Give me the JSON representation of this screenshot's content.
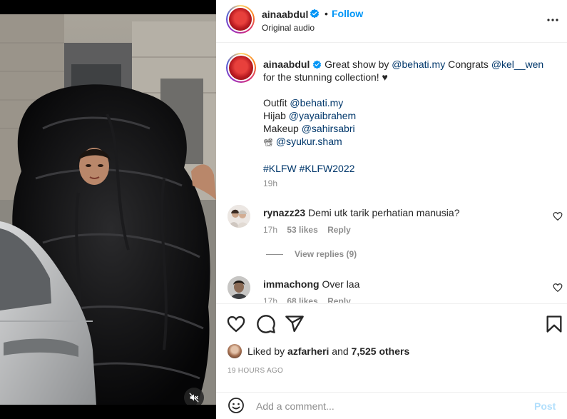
{
  "header": {
    "username": "ainaabdul",
    "separator": "•",
    "follow_label": "Follow",
    "audio": "Original audio",
    "more_icon": "more-horizontal-icon"
  },
  "caption": {
    "username": "ainaabdul",
    "text1": "Great show by",
    "mention1": "@behati.my",
    "text2": "Congrats",
    "mention2": "@kel__wen",
    "text3": "for the stunning collection! ♥",
    "outfit_label": "Outfit",
    "outfit_mention": "@behati.my",
    "hijab_label": "Hijab",
    "hijab_mention": "@yayaibrahem",
    "makeup_label": "Makeup",
    "makeup_mention": "@sahirsabri",
    "camera_emoji": "📽",
    "camera_mention": "@syukur.sham",
    "hashtag1": "#KLFW",
    "hashtag2": "#KLFW2022",
    "time": "19h"
  },
  "comments": [
    {
      "username": "rynazz23",
      "text": "Demi utk tarik perhatian manusia?",
      "time": "17h",
      "likes": "53 likes",
      "reply": "Reply",
      "view_replies": "View replies (9)"
    },
    {
      "username": "immachong",
      "text": "Over laa",
      "time": "17h",
      "likes": "68 likes",
      "reply": "Reply"
    }
  ],
  "actions": {
    "icons": [
      "heart-icon",
      "comment-icon",
      "share-icon",
      "bookmark-icon"
    ],
    "liked_by_prefix": "Liked by",
    "liked_by_user": "azfarheri",
    "liked_by_and": "and",
    "liked_by_others": "7,525 others",
    "date": "19 HOURS AGO"
  },
  "add_comment": {
    "placeholder": "Add a comment...",
    "post_label": "Post",
    "emoji_icon": "smiley-icon"
  },
  "media": {
    "mute_icon": "speaker-muted-icon"
  },
  "colors": {
    "accent": "#0095f6",
    "mention": "#00376b",
    "muted": "#8e8e8e",
    "post_disabled": "#b2dffc"
  }
}
